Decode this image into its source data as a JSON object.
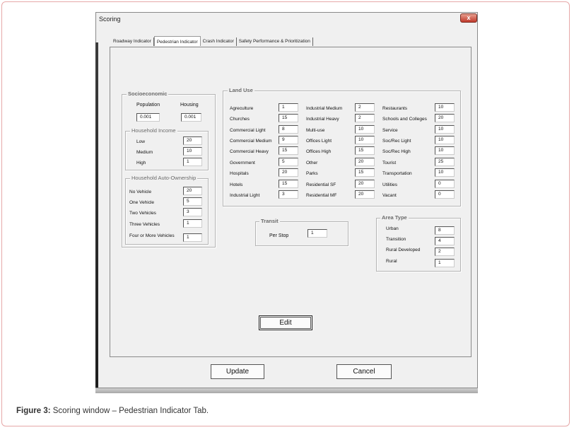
{
  "window": {
    "title": "Scoring",
    "close_label": "x"
  },
  "tabs": [
    {
      "label": "Roadway Indicator",
      "active": false
    },
    {
      "label": "Pedestrian Indicator",
      "active": true
    },
    {
      "label": "Crash Indicator",
      "active": false
    },
    {
      "label": "Safety Performance & Prioritization",
      "active": false
    }
  ],
  "socioeconomic": {
    "title": "Socioeconomic",
    "population_label": "Population",
    "population_value": "0.001",
    "housing_label": "Housing",
    "housing_value": "0.001"
  },
  "household_income": {
    "title": "Household Income",
    "rows": [
      {
        "label": "Low",
        "value": "20"
      },
      {
        "label": "Medium",
        "value": "10"
      },
      {
        "label": "High",
        "value": "1"
      }
    ]
  },
  "auto_ownership": {
    "title": "Household Auto-Ownership",
    "rows": [
      {
        "label": "No Vehicle",
        "value": "20"
      },
      {
        "label": "One Vehicle",
        "value": "5"
      },
      {
        "label": "Two Vehicles",
        "value": "3"
      },
      {
        "label": "Three Vehicles",
        "value": "1"
      },
      {
        "label": "Four or More Vehicles",
        "value": "1"
      }
    ]
  },
  "land_use": {
    "title": "Land Use",
    "col1": [
      {
        "label": "Agreculture",
        "value": "1"
      },
      {
        "label": "Churches",
        "value": "15"
      },
      {
        "label": "Commercial Light",
        "value": "8"
      },
      {
        "label": "Commercial Medium",
        "value": "9"
      },
      {
        "label": "Commercial Heavy",
        "value": "15"
      },
      {
        "label": "Government",
        "value": "5"
      },
      {
        "label": "Hospitals",
        "value": "20"
      },
      {
        "label": "Hotels",
        "value": "15"
      },
      {
        "label": "Industrial Light",
        "value": "3"
      }
    ],
    "col2": [
      {
        "label": "Industrial Medium",
        "value": "2"
      },
      {
        "label": "Industrial Heavy",
        "value": "2"
      },
      {
        "label": "Multi-use",
        "value": "10"
      },
      {
        "label": "Offices Light",
        "value": "10"
      },
      {
        "label": "Offices High",
        "value": "15"
      },
      {
        "label": "Other",
        "value": "20"
      },
      {
        "label": "Parks",
        "value": "15"
      },
      {
        "label": "Residential SF",
        "value": "20"
      },
      {
        "label": "Residential MF",
        "value": "20"
      }
    ],
    "col3": [
      {
        "label": "Restaurants",
        "value": "10"
      },
      {
        "label": "Schools and Colleges",
        "value": "20"
      },
      {
        "label": "Service",
        "value": "10"
      },
      {
        "label": "Soc/Rec Light",
        "value": "10"
      },
      {
        "label": "Soc/Rec High",
        "value": "10"
      },
      {
        "label": "Tourist",
        "value": "25"
      },
      {
        "label": "Transportation",
        "value": "10"
      },
      {
        "label": "Utilities",
        "value": "0"
      },
      {
        "label": "Vacant",
        "value": "0"
      }
    ]
  },
  "transit": {
    "title": "Transit",
    "label": "Per Stop",
    "value": "1"
  },
  "area_type": {
    "title": "Area Type",
    "rows": [
      {
        "label": "Urban",
        "value": "8"
      },
      {
        "label": "Transition",
        "value": "4"
      },
      {
        "label": "Rural Developed",
        "value": "2"
      },
      {
        "label": "Rural",
        "value": "1"
      }
    ]
  },
  "buttons": {
    "edit": "Edit",
    "update": "Update",
    "cancel": "Cancel"
  },
  "caption": {
    "figure": "Figure 3:",
    "text": " Scoring window – Pedestrian Indicator Tab."
  }
}
